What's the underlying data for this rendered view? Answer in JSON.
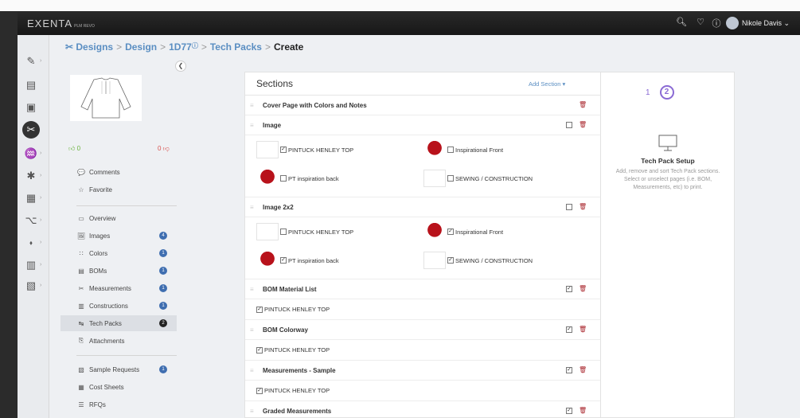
{
  "app": {
    "logo": "EXENTA",
    "logo_sub": "PLM REVO"
  },
  "topbar": {
    "user_name": "Nikole Davis ⌄"
  },
  "breadcrumb": [
    "Designs",
    "Design",
    "1D77",
    "Tech Packs",
    "Create"
  ],
  "side": {
    "likes": "0",
    "dislikes": "0",
    "actions": [
      {
        "label": "Comments",
        "icon": "💬"
      },
      {
        "label": "Favorite",
        "icon": "☆"
      }
    ],
    "nav": [
      {
        "label": "Overview",
        "icon": "▭",
        "count": ""
      },
      {
        "label": "Images",
        "icon": "🖼",
        "count": "4"
      },
      {
        "label": "Colors",
        "icon": "∷",
        "count": "1"
      },
      {
        "label": "BOMs",
        "icon": "▤",
        "count": "1"
      },
      {
        "label": "Measurements",
        "icon": "✂",
        "count": "1"
      },
      {
        "label": "Constructions",
        "icon": "▥",
        "count": "1"
      },
      {
        "label": "Tech Packs",
        "icon": "↹",
        "count": "2"
      },
      {
        "label": "Attachments",
        "icon": "⎘",
        "count": ""
      }
    ],
    "extra": [
      {
        "label": "Sample Requests",
        "icon": "▧",
        "count": "1"
      },
      {
        "label": "Cost Sheets",
        "icon": "▦",
        "count": ""
      },
      {
        "label": "RFQs",
        "icon": "☰",
        "count": ""
      }
    ]
  },
  "sections": {
    "title": "Sections",
    "add_label": "Add Section ▾",
    "cover": "Cover Page with Colors and Notes",
    "image": {
      "title": "Image",
      "items": [
        {
          "label": "PINTUCK HENLEY TOP",
          "checked": "✓"
        },
        {
          "label": "Inspirational Front",
          "checked": ""
        },
        {
          "label": "PT inspiration back",
          "checked": ""
        },
        {
          "label": "SEWING / CONSTRUCTION",
          "checked": ""
        }
      ]
    },
    "image2x2": {
      "title": "Image 2x2",
      "items": [
        {
          "label": "PINTUCK HENLEY TOP",
          "checked": ""
        },
        {
          "label": "Inspirational Front",
          "checked": "✓"
        },
        {
          "label": "PT inspiration back",
          "checked": "✓"
        },
        {
          "label": "SEWING / CONSTRUCTION",
          "checked": "✓"
        }
      ]
    },
    "bom_material": {
      "title": "BOM Material List",
      "item": "PINTUCK HENLEY TOP"
    },
    "bom_colorway": {
      "title": "BOM Colorway",
      "item": "PINTUCK HENLEY TOP"
    },
    "meas_sample": {
      "title": "Measurements - Sample",
      "item": "PINTUCK HENLEY TOP"
    },
    "graded": {
      "title": "Graded Measurements"
    }
  },
  "setup": {
    "step1": "1",
    "step2": "2",
    "title": "Tech Pack Setup",
    "description": "Add, remove and sort Tech Pack sections. Select or unselect pages (i.e. BOM, Measurements, etc) to print."
  }
}
